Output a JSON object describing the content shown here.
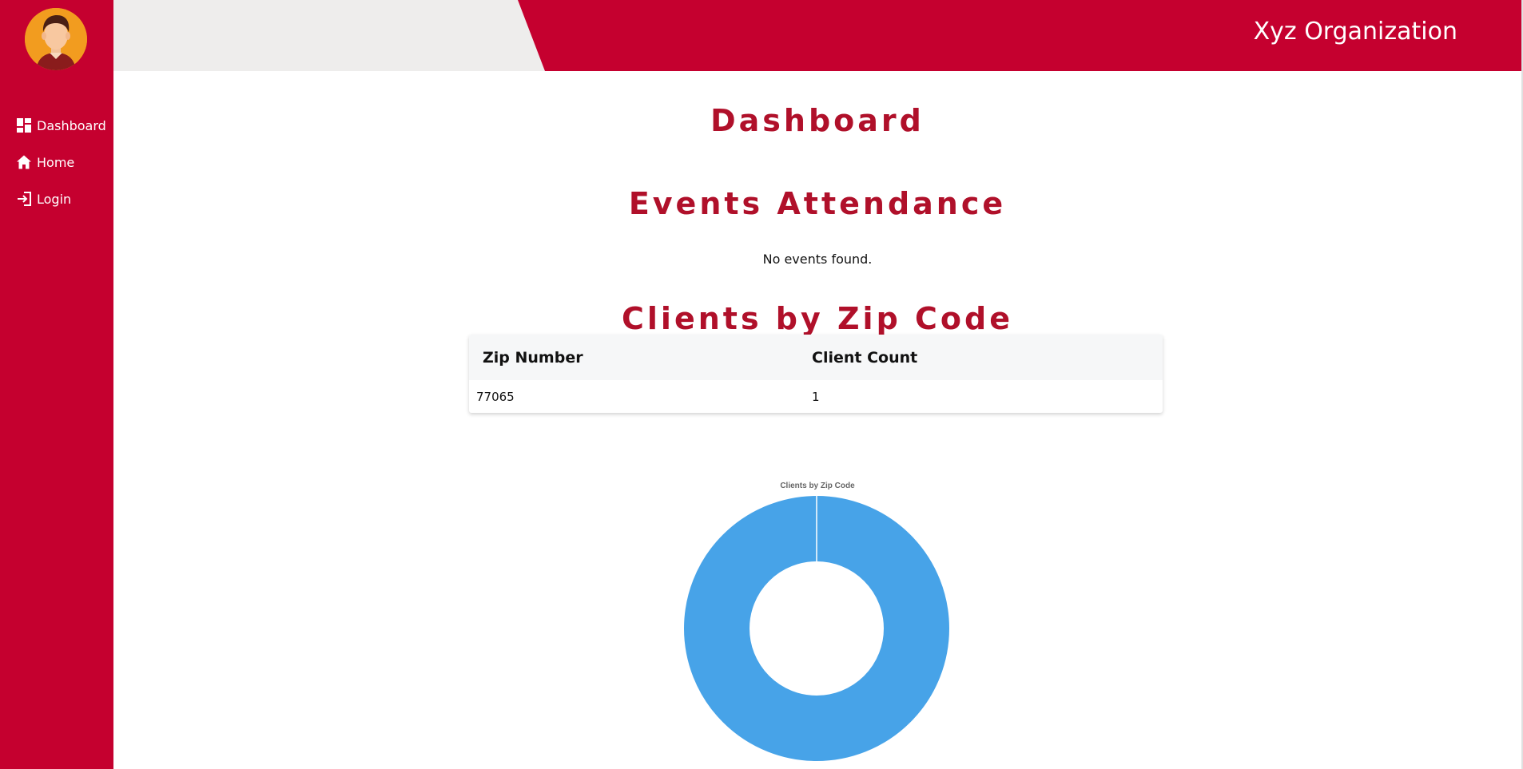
{
  "sidebar": {
    "items": [
      {
        "label": "Dashboard",
        "icon": "dashboard-icon"
      },
      {
        "label": "Home",
        "icon": "home-icon"
      },
      {
        "label": "Login",
        "icon": "login-icon"
      }
    ]
  },
  "header": {
    "org_name": "Xyz Organization"
  },
  "main": {
    "title": "Dashboard",
    "events": {
      "heading": "Events Attendance",
      "empty_message": "No events found."
    },
    "clients": {
      "heading": "Clients by Zip Code",
      "table": {
        "columns": [
          "Zip Number",
          "Client Count"
        ],
        "rows": [
          [
            "77065",
            "1"
          ]
        ]
      }
    }
  },
  "colors": {
    "brand_red": "#c5002f",
    "heading_red": "#b0102a",
    "chart_blue": "#47a3e8"
  },
  "chart_data": {
    "type": "pie",
    "variant": "doughnut",
    "title": "Clients by Zip Code",
    "categories": [
      "77065"
    ],
    "values": [
      1
    ],
    "legend": "none"
  }
}
